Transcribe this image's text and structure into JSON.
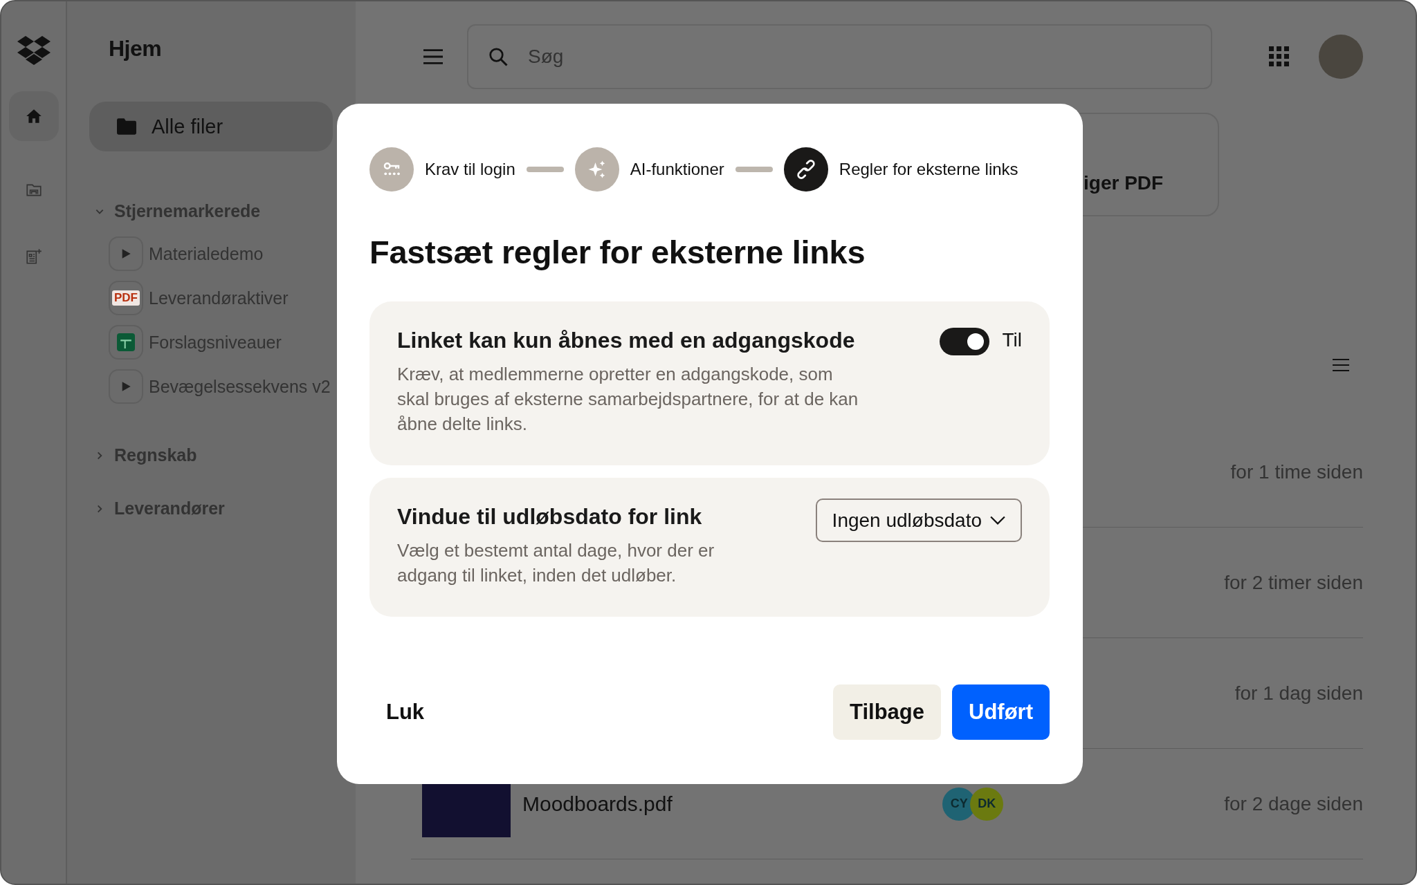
{
  "sidebar": {
    "title": "Hjem",
    "all_files": {
      "label": "Alle filer",
      "selected": true
    },
    "sections": [
      {
        "label": "Stjernemarkerede",
        "expanded": true,
        "children": [
          {
            "label": "Materialedemo",
            "kind": "video"
          },
          {
            "label": "Leverandøraktiver",
            "kind": "pdf",
            "badge": "PDF"
          },
          {
            "label": "Forslagsniveauer",
            "kind": "sheet"
          },
          {
            "label": "Bevægelsessekvens v2",
            "kind": "video"
          }
        ]
      },
      {
        "label": "Regnskab",
        "expanded": false
      },
      {
        "label": "Leverandører",
        "expanded": false
      }
    ]
  },
  "header": {
    "search": {
      "placeholder": "Søg"
    }
  },
  "card": {
    "label": "iger PDF"
  },
  "rows": [
    {
      "modified": "for 1 time siden"
    },
    {
      "modified": "for 2 timer siden"
    },
    {
      "modified": "for 1 dag siden"
    },
    {
      "name": "Moodboards.pdf",
      "modified": "for 2 dage siden",
      "members": [
        {
          "initials": "CY",
          "color": "#1f6373"
        },
        {
          "initials": "DK",
          "color": "#6b7a10"
        }
      ]
    }
  ],
  "dialog": {
    "steps": [
      {
        "label": "Krav til login",
        "selected": false
      },
      {
        "label": "AI-funktioner",
        "selected": false
      },
      {
        "label": "Regler for eksterne links",
        "selected": true
      }
    ],
    "title": "Fastsæt regler for eksterne links",
    "settings": [
      {
        "kind": "toggle",
        "title": "Linket kan kun åbnes med en adgangskode",
        "description": "Kræv, at medlemmerne opretter en adgangskode, som skal bruges af eksterne samarbejdspartnere, for at de kan åbne delte links.",
        "on": true,
        "state_label": "Til"
      },
      {
        "kind": "dropdown",
        "title": "Vindue til udløbsdato for link",
        "description": "Vælg et bestemt antal dage, hvor der er adgang til linket, inden det udløber.",
        "value": "Ingen udløbsdato"
      }
    ],
    "close": "Luk",
    "back": "Tilbage",
    "done": "Udført"
  }
}
